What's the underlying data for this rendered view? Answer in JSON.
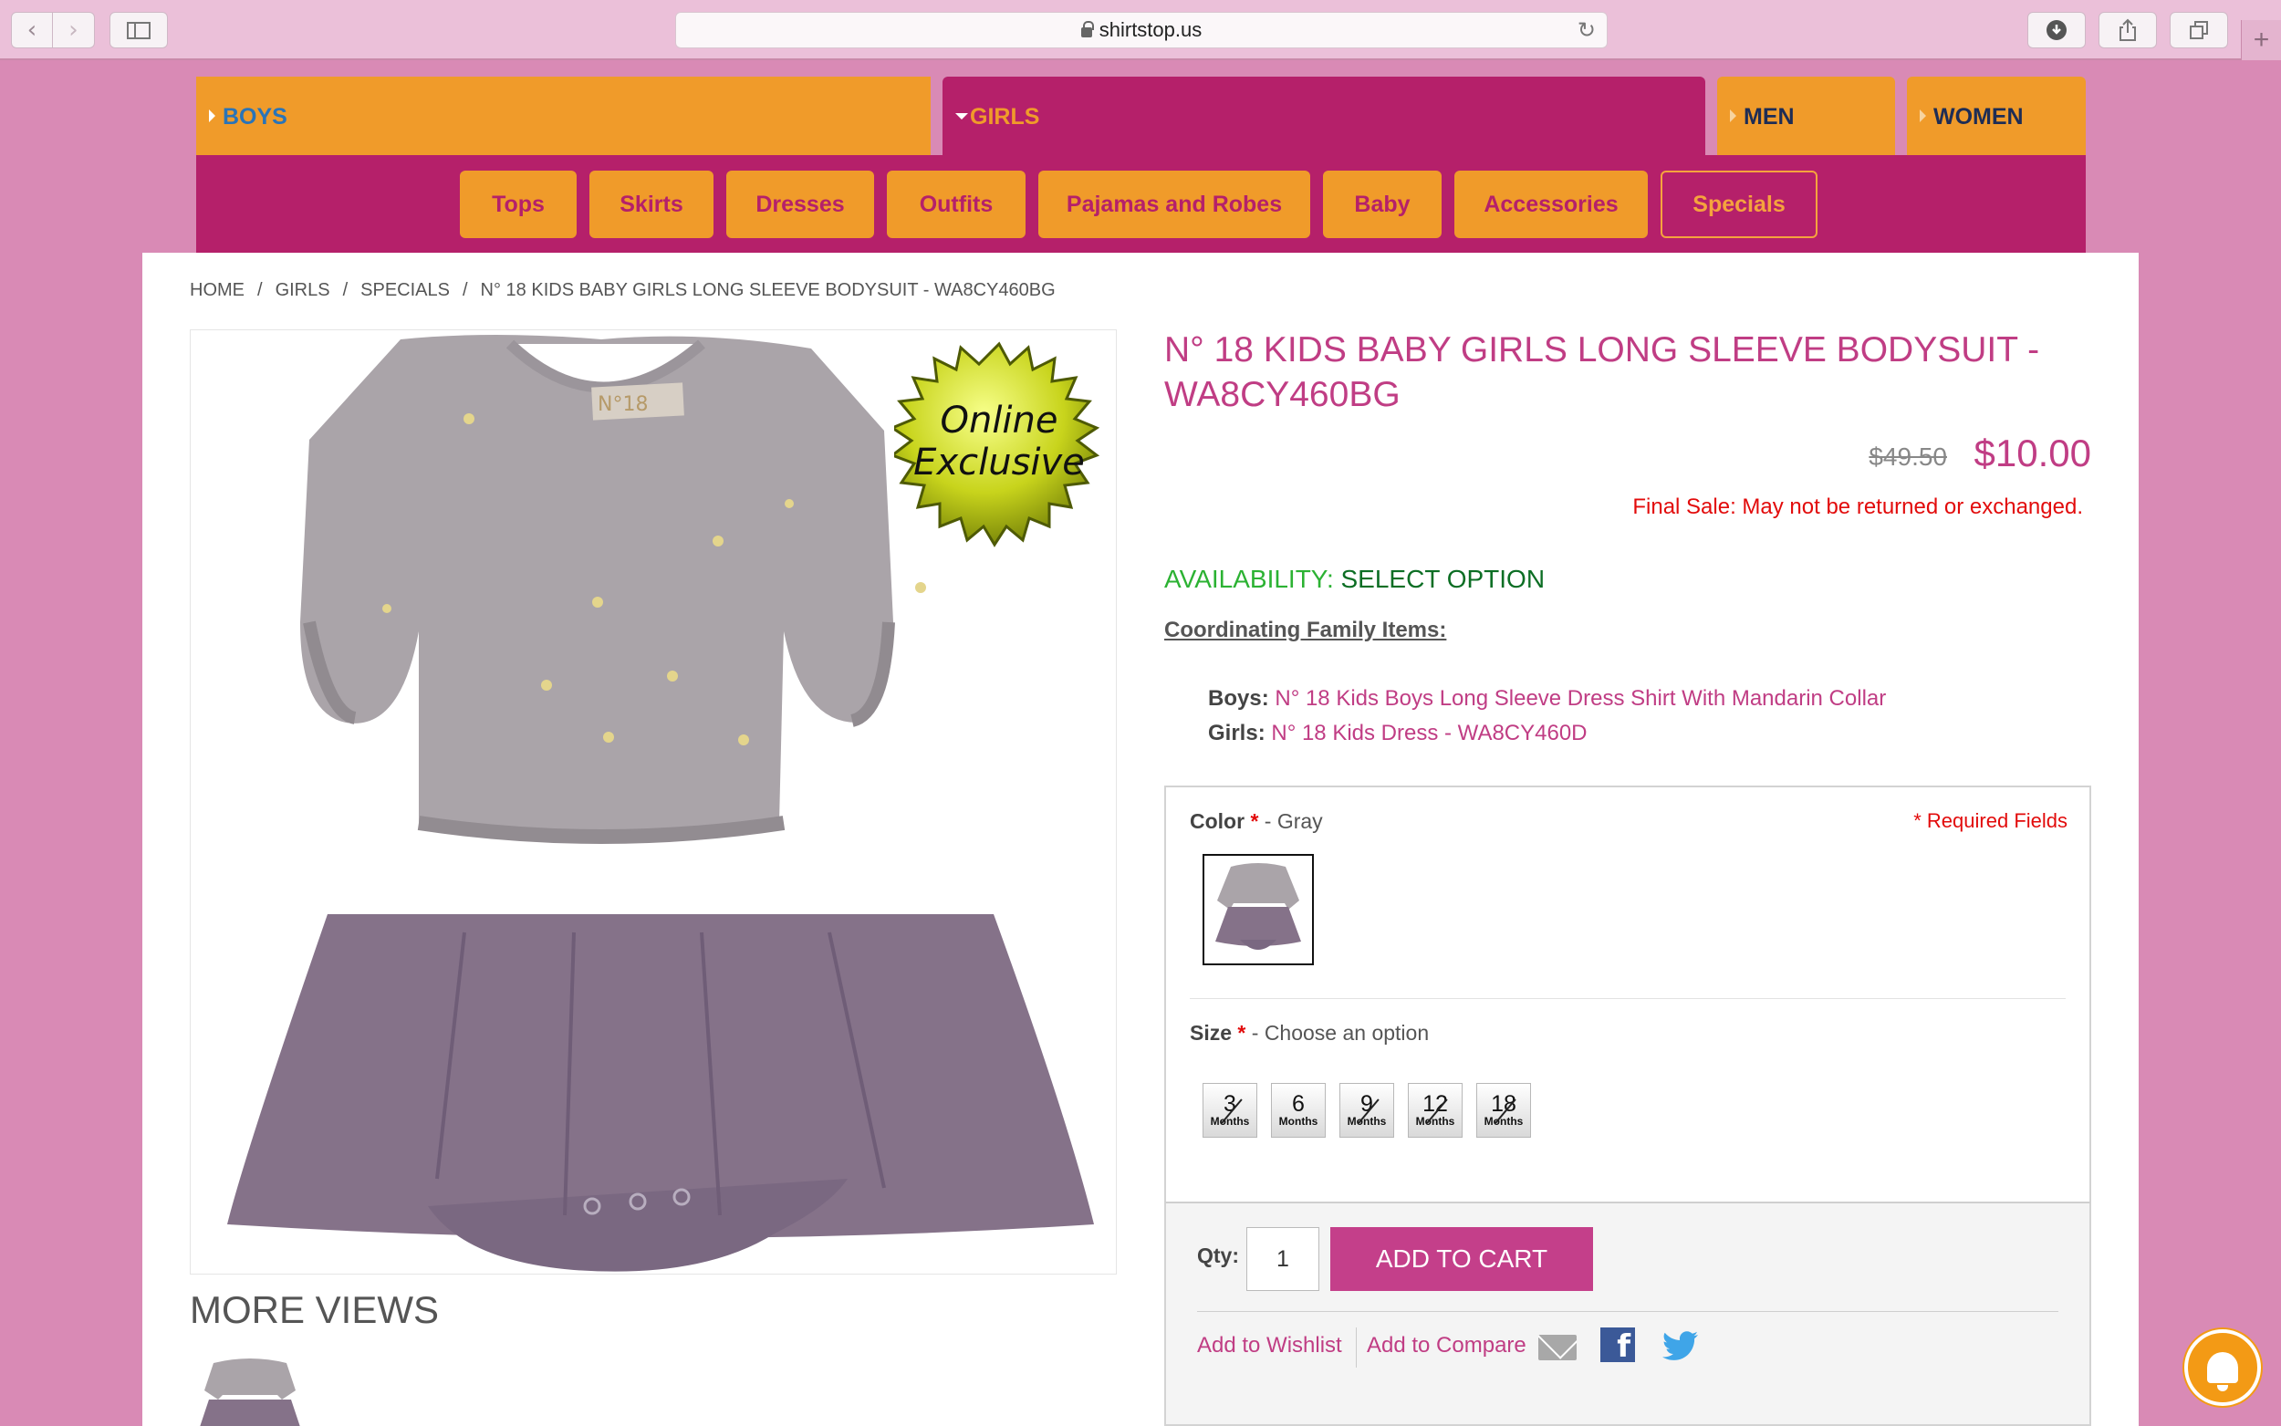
{
  "browser": {
    "url": "shirtstop.us",
    "back_glyph": "‹",
    "forward_glyph": "›",
    "reload_glyph": "↻",
    "new_tab_glyph": "+"
  },
  "gender_tabs": [
    {
      "label": "BOYS"
    },
    {
      "label": "GIRLS"
    },
    {
      "label": "MEN"
    },
    {
      "label": "WOMEN"
    }
  ],
  "categories": [
    "Tops",
    "Skirts",
    "Dresses",
    "Outfits",
    "Pajamas and Robes",
    "Baby",
    "Accessories",
    "Specials"
  ],
  "breadcrumb": [
    "HOME",
    "GIRLS",
    "SPECIALS",
    "N° 18 KIDS BABY GIRLS LONG SLEEVE BODYSUIT - WA8CY460BG"
  ],
  "breadcrumb_sep": "/",
  "product": {
    "title": "N° 18 KIDS BABY GIRLS LONG SLEEVE BODYSUIT - WA8CY460BG",
    "old_price": "$49.50",
    "price": "$10.00",
    "final_sale": "Final Sale: May not be returned or exchanged.",
    "availability_label": "AVAILABILITY:",
    "availability_value": "SELECT OPTION",
    "badge_line1": "Online",
    "badge_line2": "Exclusive",
    "garment_tag": "N°18"
  },
  "coordinating": {
    "heading": "Coordinating Family Items:",
    "items": [
      {
        "label": "Boys:",
        "link": "N° 18 Kids Boys Long Sleeve Dress Shirt With Mandarin Collar"
      },
      {
        "label": "Girls:",
        "link": "N° 18 Kids Dress - WA8CY460D"
      }
    ]
  },
  "options": {
    "required_note": "* Required Fields",
    "color_label": "Color",
    "color_value": "- Gray",
    "size_label": "Size",
    "size_value": "- Choose an option",
    "star": "*",
    "sizes": [
      {
        "n": "3",
        "unit": "Months",
        "available": false
      },
      {
        "n": "6",
        "unit": "Months",
        "available": true
      },
      {
        "n": "9",
        "unit": "Months",
        "available": false
      },
      {
        "n": "12",
        "unit": "Months",
        "available": false
      },
      {
        "n": "18",
        "unit": "Months",
        "available": false
      }
    ]
  },
  "cart": {
    "qty_label": "Qty:",
    "qty_value": "1",
    "add_to_cart": "ADD TO CART",
    "wishlist": "Add to Wishlist",
    "compare": "Add to Compare",
    "facebook_glyph": "f",
    "twitter_glyph": "🐦"
  },
  "more_views": "MORE VIEWS",
  "colors": {
    "orange": "#f09b2a",
    "magenta": "#b5206a",
    "link": "#c03d84",
    "sale_red": "#e20b0b",
    "green": "#2cb233"
  }
}
